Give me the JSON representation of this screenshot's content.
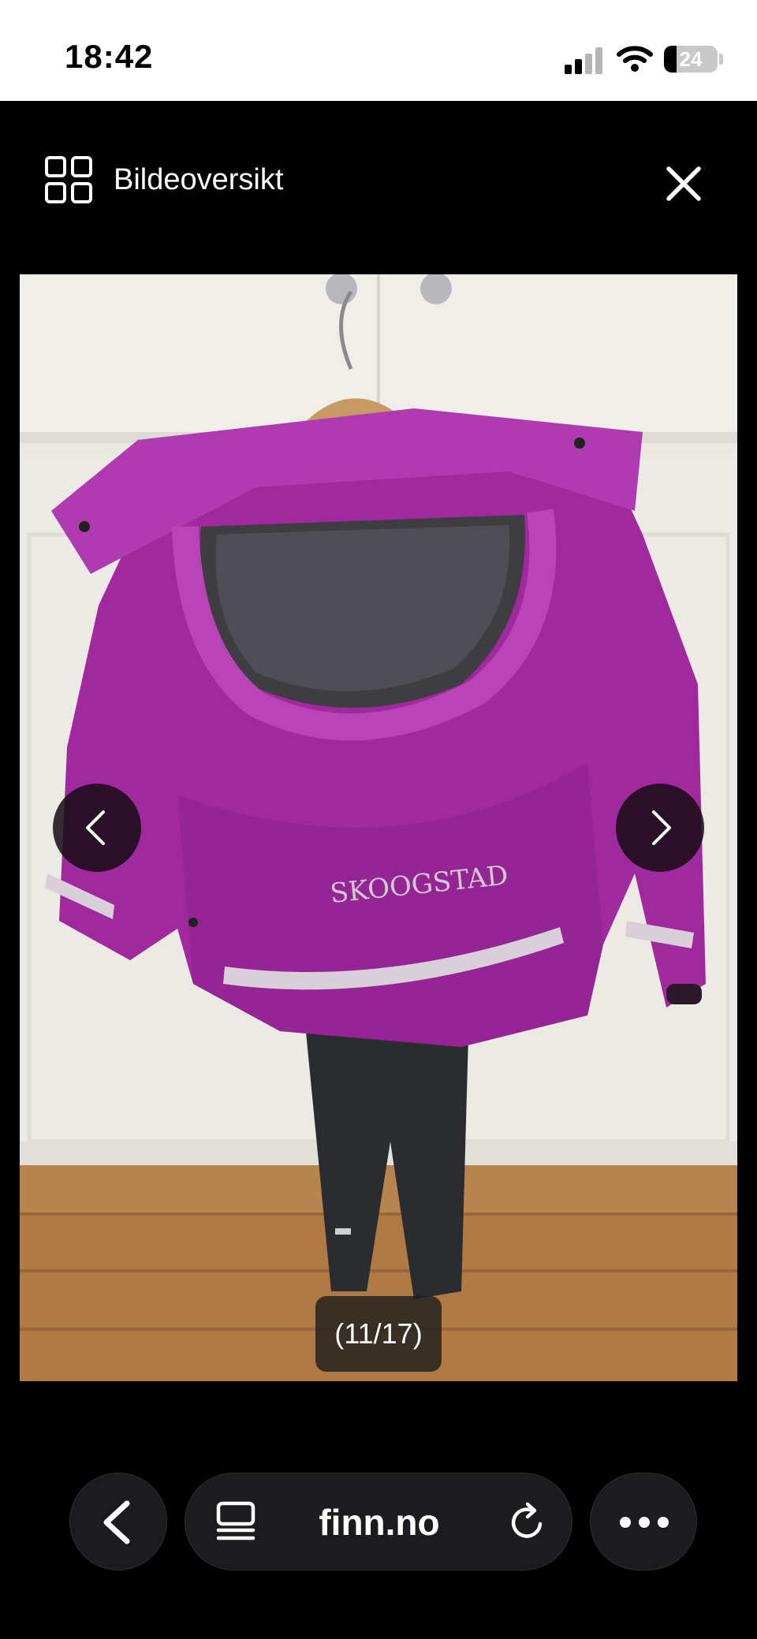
{
  "status_bar": {
    "time": "18:42",
    "battery_level": "24",
    "icons": [
      "cellular-signal-icon",
      "wifi-icon",
      "battery-icon"
    ]
  },
  "gallery_header": {
    "overview_label": "Bildeoversikt",
    "overview_icon": "grid-icon",
    "close_icon": "close-icon"
  },
  "photo": {
    "brand_print": "SKOOGSTAD",
    "prev_icon": "chevron-left-icon",
    "next_icon": "chevron-right-icon",
    "counter": "(11/17)"
  },
  "browser_bar": {
    "url": "finn.no",
    "back_icon": "chevron-left-icon",
    "reader_icon": "reader-mode-icon",
    "reload_icon": "reload-icon",
    "more_icon": "more-icon"
  },
  "colors": {
    "jacket": "#a0299e",
    "background": "#000000",
    "status_bar": "#ffffff"
  }
}
